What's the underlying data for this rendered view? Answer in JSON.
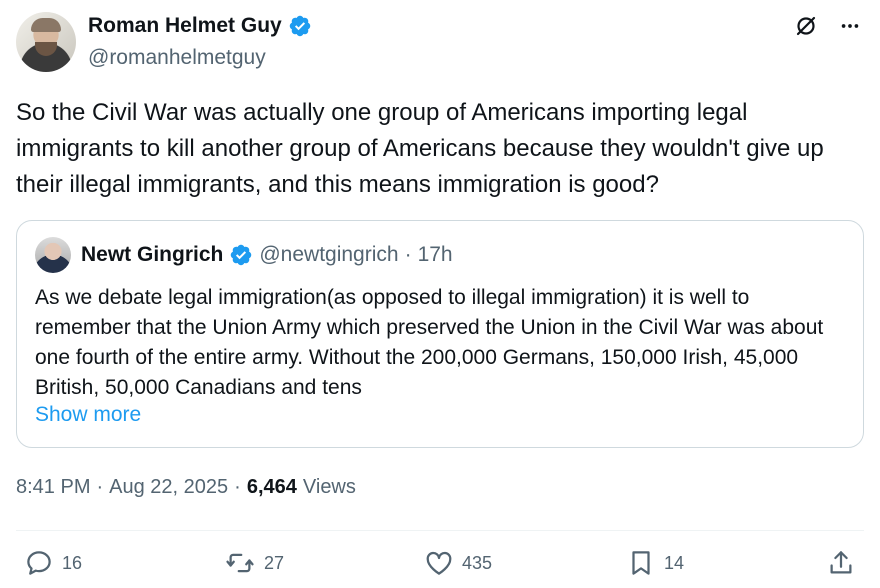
{
  "author": {
    "display_name": "Roman Helmet Guy",
    "handle": "@romanhelmetguy"
  },
  "post": {
    "text": "So the Civil War was actually one group of Americans importing legal immigrants to kill another group of Americans because they wouldn't give up their illegal immigrants, and this means immigration is good?",
    "time": "8:41 PM",
    "date": "Aug 22, 2025",
    "views_count": "6,464",
    "views_label": "Views",
    "separator": "·"
  },
  "quote": {
    "display_name": "Newt Gingrich",
    "handle": "@newtgingrich",
    "age": "17h",
    "separator": "·",
    "text": "As we debate legal immigration(as opposed to illegal immigration) it is well to remember that the Union Army which preserved the Union in the Civil War was about one fourth of the entire army. Without the 200,000 Germans, 150,000 Irish, 45,000 British, 50,000 Canadians and tens",
    "show_more": "Show more"
  },
  "actions": {
    "replies": "16",
    "reposts": "27",
    "likes": "435",
    "bookmarks": "14"
  },
  "colors": {
    "verified": "#1d9bf0",
    "link": "#1d9bf0",
    "secondary_text": "#536471"
  },
  "icons": [
    "verified-badge-icon",
    "grok-icon",
    "more-icon",
    "reply-icon",
    "repost-icon",
    "like-icon",
    "bookmark-icon",
    "share-icon"
  ]
}
